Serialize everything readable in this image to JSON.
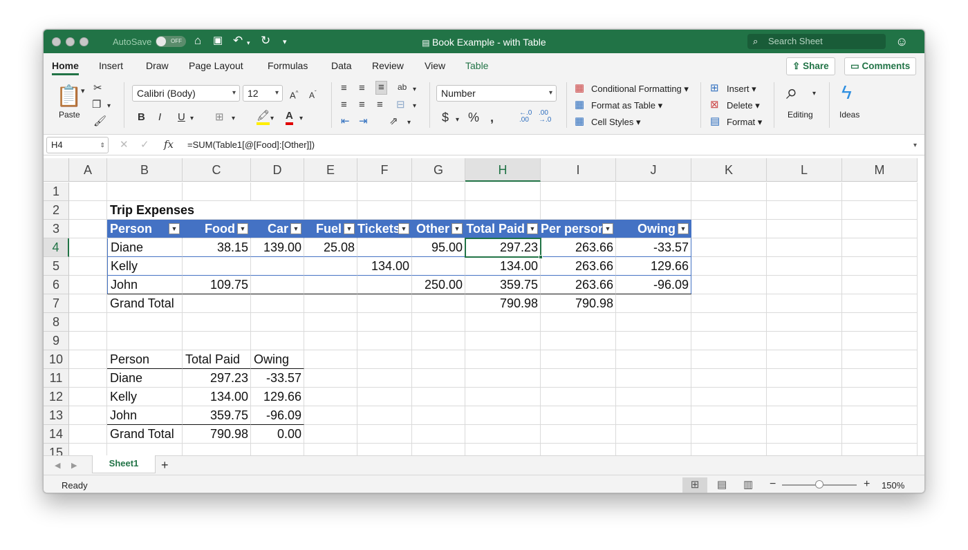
{
  "titlebar": {
    "autosave_label": "AutoSave",
    "autosave_state": "OFF",
    "title": "Book Example - with Table",
    "search_placeholder": "Search Sheet"
  },
  "tabs": [
    "Home",
    "Insert",
    "Draw",
    "Page Layout",
    "Formulas",
    "Data",
    "Review",
    "View",
    "Table"
  ],
  "active_tab": "Home",
  "share_label": "Share",
  "comments_label": "Comments",
  "ribbon": {
    "paste_label": "Paste",
    "font_name": "Calibri (Body)",
    "font_size": "12",
    "number_format": "Number",
    "conditional_formatting": "Conditional Formatting",
    "format_as_table": "Format as Table",
    "cell_styles": "Cell Styles",
    "insert": "Insert",
    "delete": "Delete",
    "format": "Format",
    "editing": "Editing",
    "ideas": "Ideas"
  },
  "formula_bar": {
    "name_box": "H4",
    "formula": "=SUM(Table1[@[Food]:[Other]])"
  },
  "columns": [
    "A",
    "B",
    "C",
    "D",
    "E",
    "F",
    "G",
    "H",
    "I",
    "J",
    "K",
    "L",
    "M"
  ],
  "rows": [
    "1",
    "2",
    "3",
    "4",
    "5",
    "6",
    "7",
    "8",
    "9",
    "10",
    "11",
    "12",
    "13",
    "14",
    "15"
  ],
  "selected_cell": "H4",
  "sheet": {
    "title": "Trip Expenses",
    "table_headers": [
      "Person",
      "Food",
      "Car",
      "Fuel",
      "Tickets",
      "Other",
      "Total Paid",
      "Per person",
      "Owing"
    ],
    "table_rows": [
      [
        "Diane",
        "38.15",
        "139.00",
        "25.08",
        "",
        "95.00",
        "297.23",
        "263.66",
        "-33.57"
      ],
      [
        "Kelly",
        "",
        "",
        "",
        "134.00",
        "",
        "134.00",
        "263.66",
        "129.66"
      ],
      [
        "John",
        "109.75",
        "",
        "",
        "",
        "250.00",
        "359.75",
        "263.66",
        "-96.09"
      ]
    ],
    "grand_total_row": [
      "Grand Total",
      "",
      "",
      "",
      "",
      "",
      "790.98",
      "790.98",
      ""
    ],
    "summary_headers": [
      "Person",
      "Total Paid",
      "Owing"
    ],
    "summary_rows": [
      [
        "Diane",
        "297.23",
        "-33.57"
      ],
      [
        "Kelly",
        "134.00",
        "129.66"
      ],
      [
        "John",
        "359.75",
        "-96.09"
      ],
      [
        "Grand Total",
        "790.98",
        "0.00"
      ]
    ]
  },
  "sheet_tab": "Sheet1",
  "status": {
    "ready": "Ready",
    "zoom": "150%",
    "zoom_level": 0.5
  },
  "colors": {
    "accent": "#217346",
    "table_header": "#4472c4"
  }
}
